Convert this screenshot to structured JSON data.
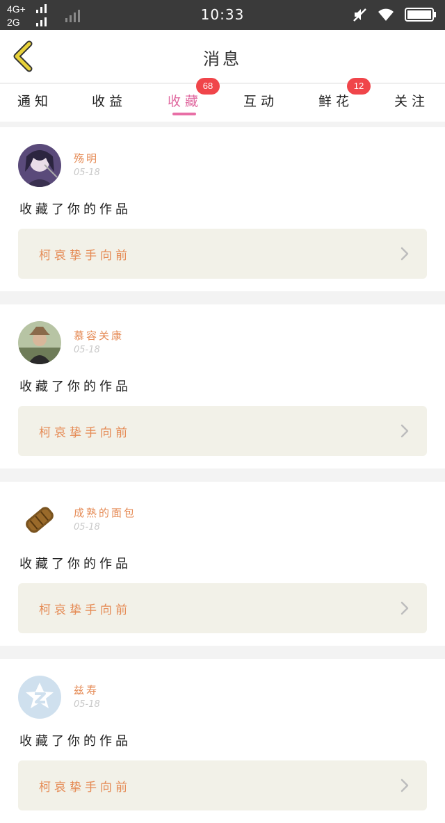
{
  "status_bar": {
    "network_top": "4G+",
    "network_bottom": "2G",
    "time": "10:33",
    "icons": [
      "signal-icon",
      "mute-icon",
      "wifi-icon",
      "battery-icon"
    ]
  },
  "header": {
    "title": "消息",
    "back_icon": "chevron-left-icon",
    "accent_color": "#e8d23a"
  },
  "tabs": [
    {
      "label": "通知",
      "badge": null,
      "active": false
    },
    {
      "label": "收益",
      "badge": null,
      "active": false
    },
    {
      "label": "收藏",
      "badge": "68",
      "active": true
    },
    {
      "label": "互动",
      "badge": null,
      "active": false
    },
    {
      "label": "鲜花",
      "badge": "12",
      "active": false
    },
    {
      "label": "关注",
      "badge": null,
      "active": false
    }
  ],
  "colors": {
    "active_tab": "#e06aa0",
    "badge": "#f0454a",
    "username": "#e58a54",
    "work_bg": "#f2f1e8"
  },
  "feed": [
    {
      "username": "殇明",
      "date": "05-18",
      "action": "收藏了你的作品",
      "work_title": "柯哀挚手向前",
      "avatar": "anime-character-avatar"
    },
    {
      "username": "慕容关康",
      "date": "05-18",
      "action": "收藏了你的作品",
      "work_title": "柯哀挚手向前",
      "avatar": "man-with-hat-avatar"
    },
    {
      "username": "成熟的面包",
      "date": "05-18",
      "action": "收藏了你的作品",
      "work_title": "柯哀挚手向前",
      "avatar": "bread-avatar"
    },
    {
      "username": "兹寿",
      "date": "05-18",
      "action": "收藏了你的作品",
      "work_title": "柯哀挚手向前",
      "avatar": "qzone-default-avatar"
    }
  ]
}
